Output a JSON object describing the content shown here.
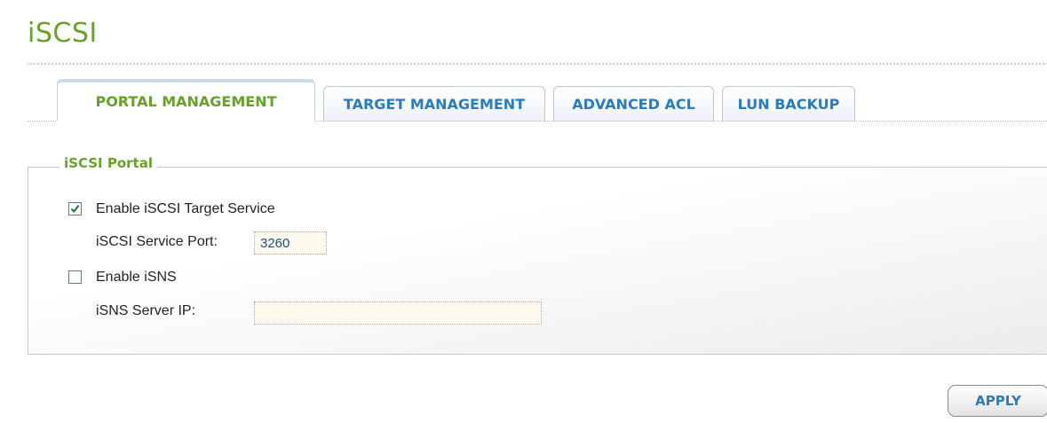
{
  "page": {
    "title": "iSCSI"
  },
  "tabs": [
    {
      "label": "PORTAL MANAGEMENT",
      "active": true
    },
    {
      "label": "TARGET MANAGEMENT",
      "active": false
    },
    {
      "label": "ADVANCED ACL",
      "active": false
    },
    {
      "label": "LUN BACKUP",
      "active": false
    }
  ],
  "portal": {
    "legend": "iSCSI Portal",
    "enable_target_service": {
      "label": "Enable iSCSI Target Service",
      "checked": true
    },
    "service_port": {
      "label": "iSCSI Service Port:",
      "value": "3260"
    },
    "enable_isns": {
      "label": "Enable iSNS",
      "checked": false
    },
    "isns_server_ip": {
      "label": "iSNS Server IP:",
      "value": ""
    }
  },
  "actions": {
    "apply_label": "APPLY"
  },
  "colors": {
    "title_green": "#66a12a",
    "tab_blue": "#2c7bbd",
    "field_bg": "#fdfaee"
  }
}
